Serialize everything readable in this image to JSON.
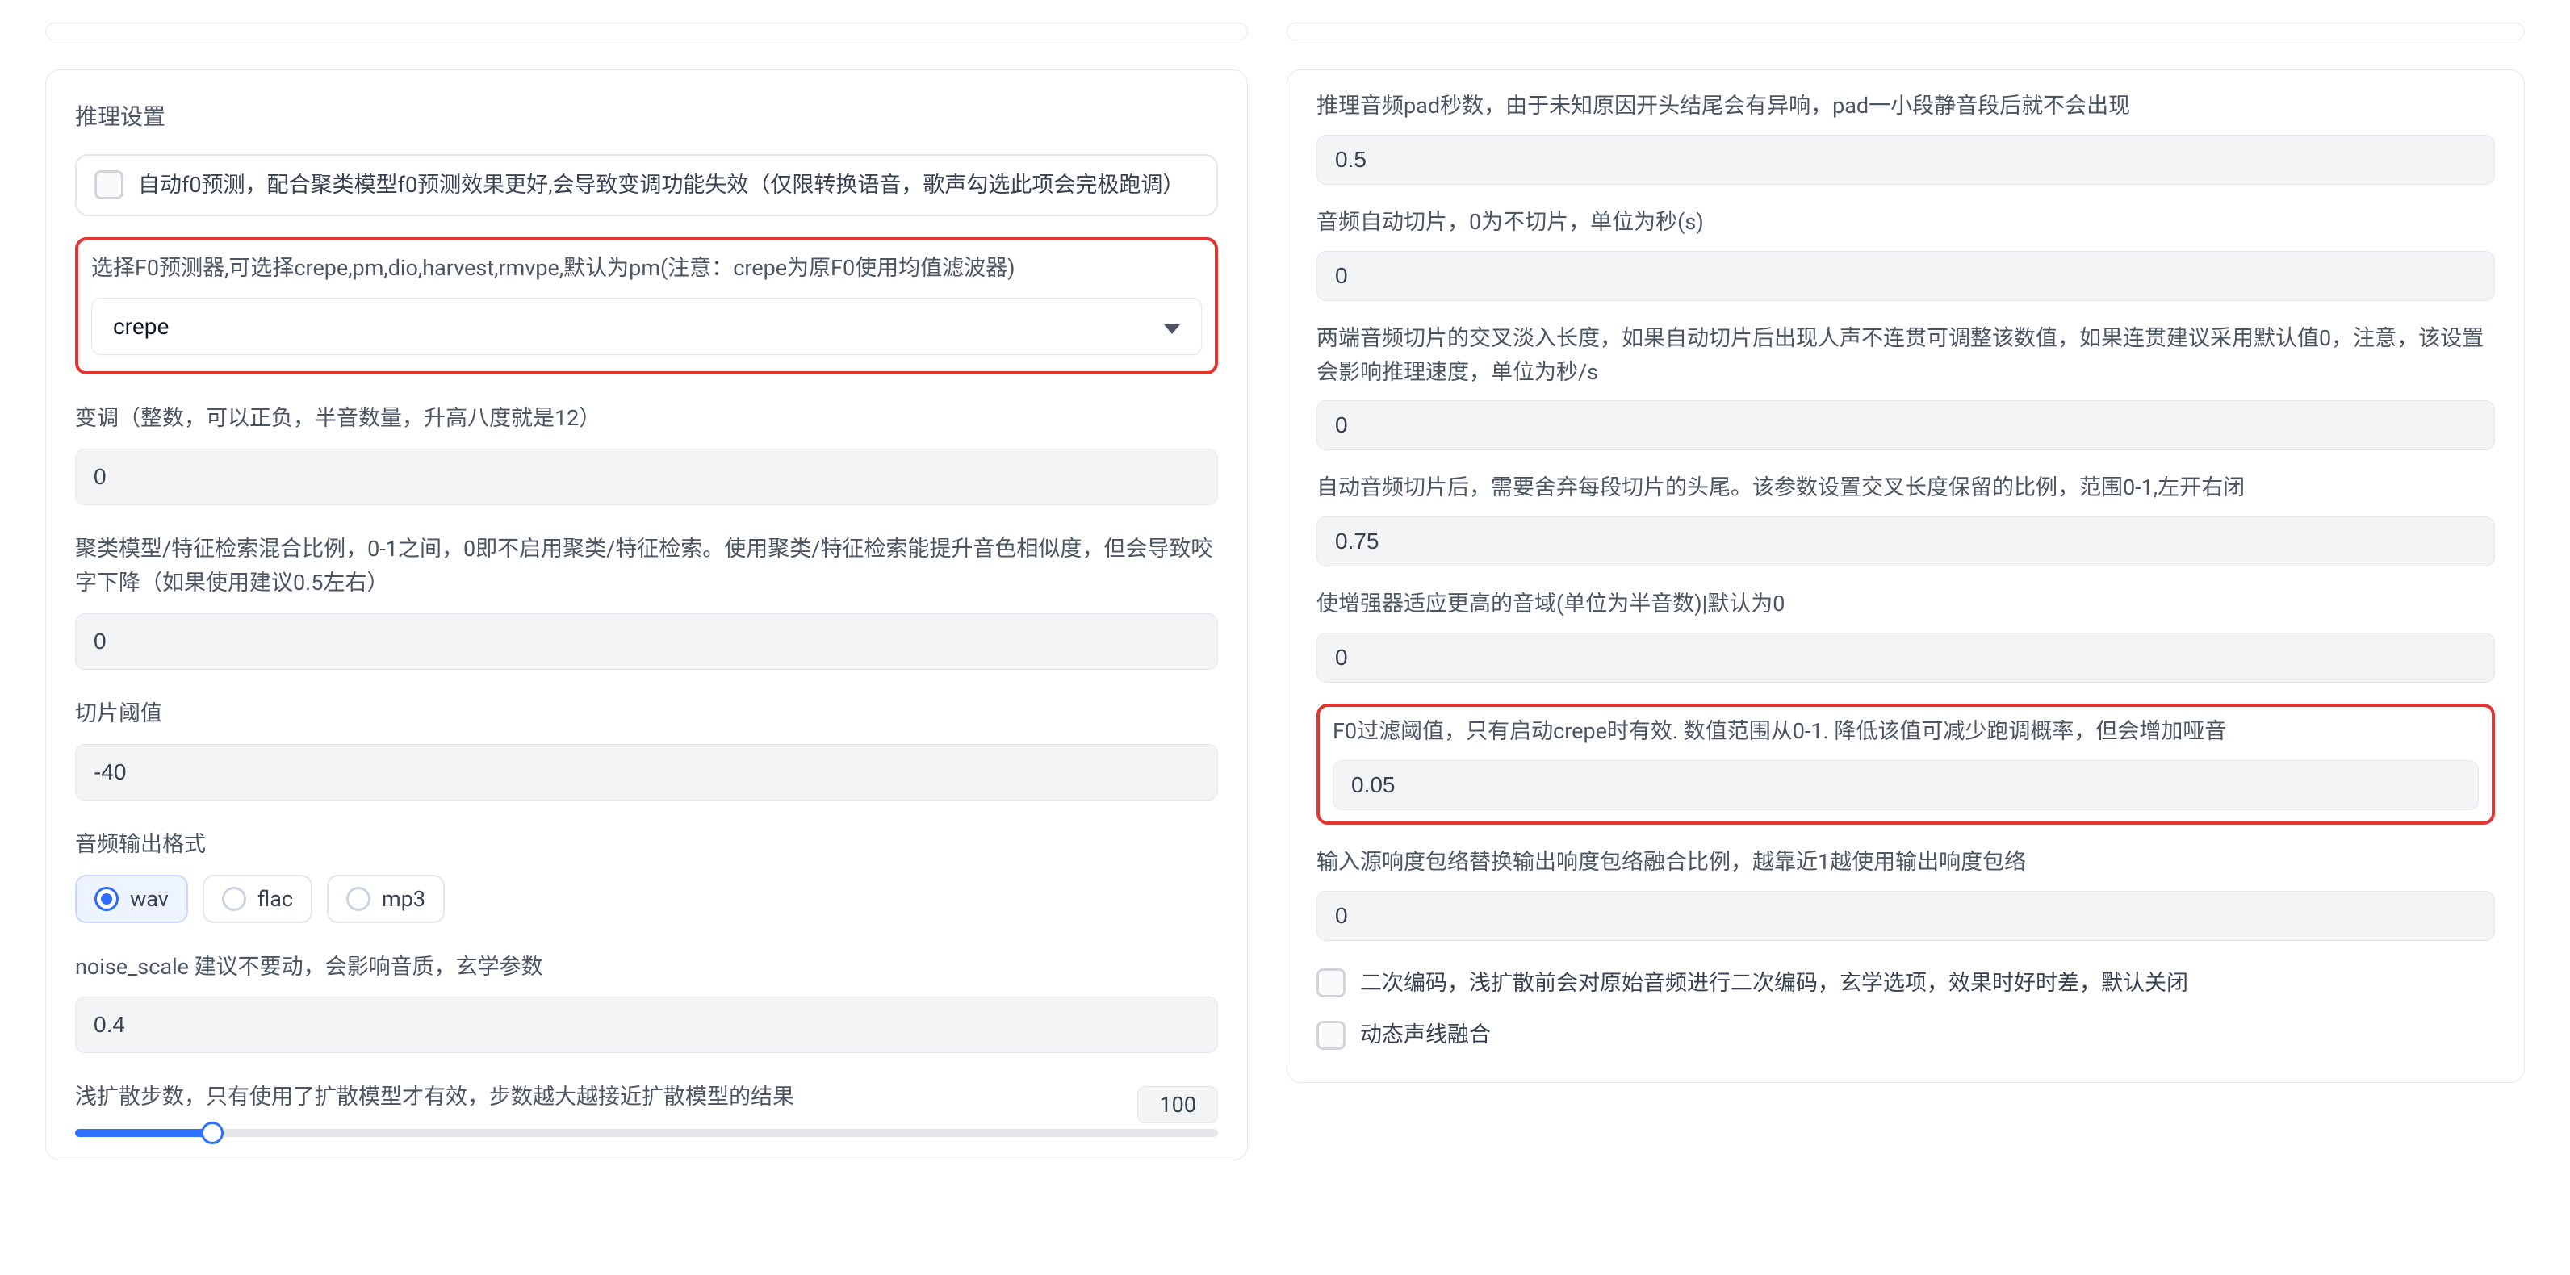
{
  "left": {
    "section_title": "推理设置",
    "auto_f0": {
      "label": "自动f0预测，配合聚类模型f0预测效果更好,会导致变调功能失效（仅限转换语音，歌声勾选此项会完极跑调）"
    },
    "predictor": {
      "label": "选择F0预测器,可选择crepe,pm,dio,harvest,rmvpe,默认为pm(注意：crepe为原F0使用均值滤波器)",
      "value": "crepe"
    },
    "transpose": {
      "label": "变调（整数，可以正负，半音数量，升高八度就是12）",
      "value": "0"
    },
    "cluster_ratio": {
      "label": "聚类模型/特征检索混合比例，0-1之间，0即不启用聚类/特征检索。使用聚类/特征检索能提升音色相似度，但会导致咬字下降（如果使用建议0.5左右）",
      "value": "0"
    },
    "slice_threshold": {
      "label": "切片阈值",
      "value": "-40"
    },
    "output_format": {
      "label": "音频输出格式",
      "options": {
        "wav": "wav",
        "flac": "flac",
        "mp3": "mp3"
      }
    },
    "noise_scale": {
      "label": "noise_scale 建议不要动，会影响音质，玄学参数",
      "value": "0.4"
    },
    "diffusion_steps": {
      "label": "浅扩散步数，只有使用了扩散模型才有效，步数越大越接近扩散模型的结果",
      "value": "100"
    }
  },
  "right": {
    "pad_seconds": {
      "label": "推理音频pad秒数，由于未知原因开头结尾会有异响，pad一小段静音段后就不会出现",
      "value": "0.5"
    },
    "auto_slice": {
      "label": "音频自动切片，0为不切片，单位为秒(s)",
      "value": "0"
    },
    "crossfade": {
      "label": "两端音频切片的交叉淡入长度，如果自动切片后出现人声不连贯可调整该数值，如果连贯建议采用默认值0，注意，该设置会影响推理速度，单位为秒/s",
      "value": "0"
    },
    "clip_ratio": {
      "label": "自动音频切片后，需要舍弃每段切片的头尾。该参数设置交叉长度保留的比例，范围0-1,左开右闭",
      "value": "0.75"
    },
    "enhancer_semitones": {
      "label": "使增强器适应更高的音域(单位为半音数)|默认为0",
      "value": "0"
    },
    "f0_filter_threshold": {
      "label": "F0过滤阈值，只有启动crepe时有效. 数值范围从0-1. 降低该值可减少跑调概率，但会增加哑音",
      "value": "0.05"
    },
    "loudness_envelope": {
      "label": "输入源响度包络替换输出响度包络融合比例，越靠近1越使用输出响度包络",
      "value": "0"
    },
    "second_encode": {
      "label": "二次编码，浅扩散前会对原始音频进行二次编码，玄学选项，效果时好时差，默认关闭"
    },
    "dynamic_voice_fusion": {
      "label": "动态声线融合"
    }
  }
}
